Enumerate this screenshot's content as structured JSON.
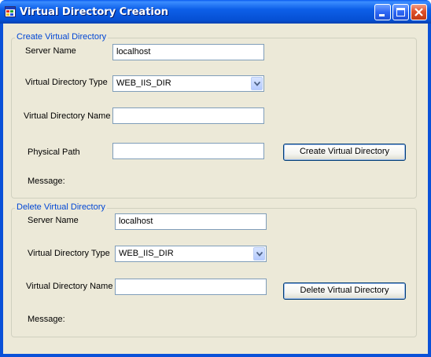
{
  "window": {
    "title": "Virtual Directory Creation",
    "icon": "app-window-icon"
  },
  "titlebar_buttons": [
    "minimize-icon",
    "maximize-icon",
    "close-icon"
  ],
  "create": {
    "legend": "Create Virtual Directory",
    "server_label": "Server Name",
    "server_value": "localhost",
    "type_label": "Virtual Directory Type",
    "type_value": "WEB_IIS_DIR",
    "name_label": "Virtual Directory Name",
    "name_value": "",
    "path_label": "Physical Path",
    "path_value": "",
    "button_label": "Create Virtual Directory",
    "message_label": "Message:"
  },
  "delete": {
    "legend": "Delete Virtual Directory",
    "server_label": "Server Name",
    "server_value": "localhost",
    "type_label": "Virtual Directory Type",
    "type_value": "WEB_IIS_DIR",
    "name_label": "Virtual Directory Name",
    "name_value": "",
    "button_label": "Delete Virtual Directory",
    "message_label": "Message:"
  }
}
